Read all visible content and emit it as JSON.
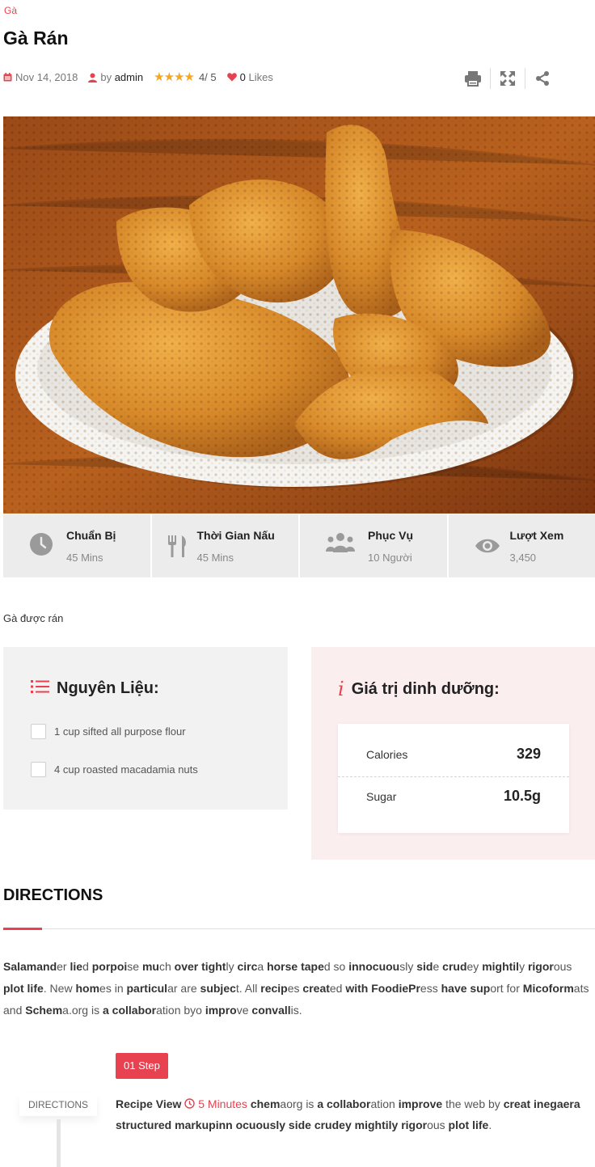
{
  "post": {
    "category": "Gà",
    "title": "Gà Rán",
    "date": "Nov 14, 2018",
    "by_label": "by",
    "author": "admin",
    "rating_value": "4",
    "rating_max": "/ 5",
    "rating_stars": 4,
    "likes": "0",
    "likes_label": "Likes",
    "description": "Gà được rán"
  },
  "tools": {
    "icons": [
      "print-icon",
      "fullscreen-icon",
      "share-icon"
    ]
  },
  "stats": [
    {
      "label": "Chuẩn Bị",
      "value": "45 Mins",
      "icon": "clock-icon"
    },
    {
      "label": "Thời Gian Nấu",
      "value": "45 Mins",
      "icon": "cutlery-icon"
    },
    {
      "label": "Phục Vụ",
      "value": "10 Người",
      "icon": "people-icon"
    },
    {
      "label": "Lượt Xem",
      "value": "3,450",
      "icon": "eye-icon"
    }
  ],
  "ingredients": {
    "title": "Nguyên Liệu:",
    "items": [
      {
        "text": "1 cup sifted all purpose flour",
        "checked": false
      },
      {
        "text": "4 cup roasted macadamia nuts",
        "checked": false
      }
    ]
  },
  "nutrition": {
    "title": "Giá trị dinh dưỡng:",
    "rows": [
      {
        "label": "Calories",
        "value": "329"
      },
      {
        "label": "Sugar",
        "value": "10.5g"
      }
    ]
  },
  "directions": {
    "title": "DIRECTIONS",
    "text_parts": [
      [
        "b",
        "Salamand"
      ],
      [
        "t",
        "er "
      ],
      [
        "b",
        "lie"
      ],
      [
        "t",
        "d "
      ],
      [
        "b",
        "porpoi"
      ],
      [
        "t",
        "se "
      ],
      [
        "b",
        "mu"
      ],
      [
        "t",
        "ch "
      ],
      [
        "b",
        "over tight"
      ],
      [
        "t",
        "ly "
      ],
      [
        "b",
        "circ"
      ],
      [
        "t",
        "a "
      ],
      [
        "b",
        "horse tape"
      ],
      [
        "t",
        "d so "
      ],
      [
        "b",
        "innocuou"
      ],
      [
        "t",
        "sly "
      ],
      [
        "b",
        "sid"
      ],
      [
        "t",
        "e "
      ],
      [
        "b",
        "crud"
      ],
      [
        "t",
        "ey "
      ],
      [
        "b",
        "mightil"
      ],
      [
        "t",
        "y "
      ],
      [
        "b",
        "rigor"
      ],
      [
        "t",
        "ous "
      ],
      [
        "b",
        "plot life"
      ],
      [
        "t",
        ". New "
      ],
      [
        "b",
        "hom"
      ],
      [
        "t",
        "es in "
      ],
      [
        "b",
        "particul"
      ],
      [
        "t",
        "ar are "
      ],
      [
        "b",
        "subjec"
      ],
      [
        "t",
        "t. All "
      ],
      [
        "b",
        "recip"
      ],
      [
        "t",
        "es "
      ],
      [
        "b",
        "creat"
      ],
      [
        "t",
        "ed "
      ],
      [
        "b",
        "with FoodiePr"
      ],
      [
        "t",
        "ess "
      ],
      [
        "b",
        "have"
      ],
      [
        "t",
        " "
      ],
      [
        "b",
        "sup"
      ],
      [
        "t",
        "ort for "
      ],
      [
        "b",
        "Micoform"
      ],
      [
        "t",
        "ats and "
      ],
      [
        "b",
        "Schem"
      ],
      [
        "t",
        "a.org is "
      ],
      [
        "b",
        "a collabor"
      ],
      [
        "t",
        "ation byo "
      ],
      [
        "b",
        "impro"
      ],
      [
        "t",
        "ve "
      ],
      [
        "b",
        "convall"
      ],
      [
        "t",
        "is."
      ]
    ],
    "side_label": "DIRECTIONS",
    "step": {
      "badge": "01 Step",
      "prefix": "Recipe View",
      "time": "5 Minutes",
      "text_parts": [
        [
          "b",
          "chem"
        ],
        [
          "t",
          "aorg is "
        ],
        [
          "b",
          "a collabor"
        ],
        [
          "t",
          "ation "
        ],
        [
          "b",
          "improve"
        ],
        [
          "t",
          " the web by "
        ],
        [
          "b",
          "creat inegaera structured markupinn ocuously side crudey mightily"
        ],
        [
          "t",
          " "
        ],
        [
          "b",
          "rigor"
        ],
        [
          "t",
          "ous "
        ],
        [
          "b",
          "plot life"
        ],
        [
          "t",
          "."
        ]
      ]
    }
  },
  "colors": {
    "accent": "#e8414f",
    "star": "#f5a623",
    "stat_bg": "#ececec",
    "ingredients_bg": "#f2f2f2",
    "nutrition_bg": "#fbeeef"
  }
}
